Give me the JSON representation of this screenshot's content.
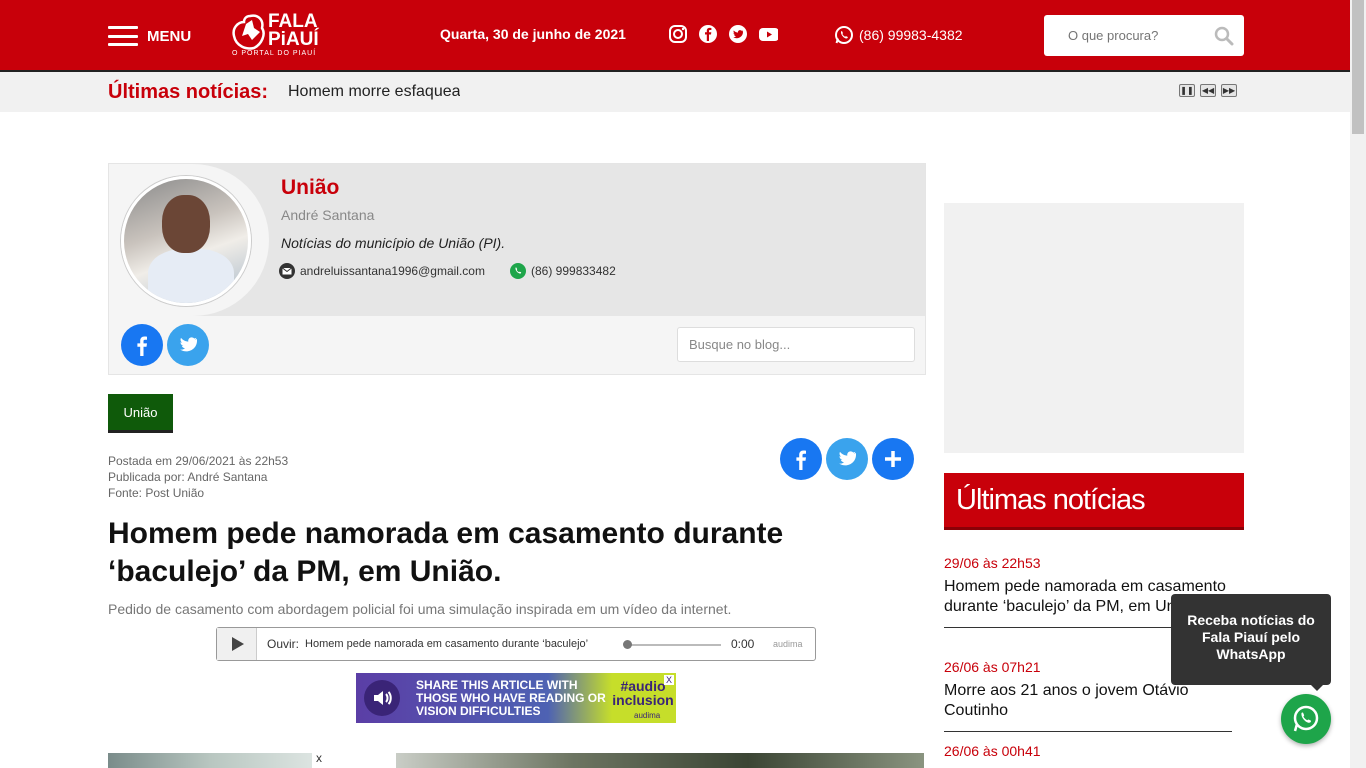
{
  "header": {
    "menu_label": "MENU",
    "logo": {
      "line1": "FALA",
      "line2": "PiAUÍ",
      "tagline": "O PORTAL DO PIAUÍ"
    },
    "date": "Quarta, 30 de junho de 2021",
    "social_icons": [
      "instagram-icon",
      "facebook-icon",
      "twitter-icon",
      "youtube-icon"
    ],
    "phone": "(86) 99983-4382",
    "search_placeholder": "O que procura?"
  },
  "ticker": {
    "label": "Últimas notícias:",
    "text": "Homem morre esfaqueado",
    "controls": [
      "pause",
      "previous",
      "next"
    ]
  },
  "blog": {
    "title": "União",
    "author": "André Santana",
    "description": "Notícias do município de União (PI).",
    "email": "andreluissantana1996@gmail.com",
    "whatsapp": "(86) 999833482",
    "search_placeholder": "Busque no blog..."
  },
  "article": {
    "category": "União",
    "posted": "Postada em 29/06/2021 às 22h53",
    "published_by": "Publicada por: André Santana",
    "source": "Fonte: Post União",
    "headline": "Homem pede namorada em casamento durante ‘baculejo’ da PM, em União.",
    "subheadline": "Pedido de casamento com abordagem policial foi uma simulação inspirada em um vídeo da internet.",
    "player": {
      "label": "Ouvir:",
      "title": "Homem pede namorada em casamento durante ‘baculejo’ da PM, em União.",
      "time": "0:00",
      "brand": "audima"
    },
    "banner": {
      "text": "SHARE THIS ARTICLE WITH THOSE WHO HAVE READING OR VISION DIFFICULTIES",
      "tag": "#audio inclusion",
      "brand": "audima",
      "close": "X"
    },
    "image_close": "x"
  },
  "sidebar": {
    "heading": "Últimas notícias",
    "news": [
      {
        "date": "29/06 às 22h53",
        "title": "Homem pede namorada em casamento durante ‘baculejo’ da PM, em União."
      },
      {
        "date": "26/06 às 07h21",
        "title": "Morre aos 21 anos o jovem Otávio Coutinho"
      },
      {
        "date": "26/06 às 00h41",
        "title": ""
      }
    ]
  },
  "whatsapp_widget": {
    "tooltip": "Receba notícias do Fala Piauí pelo WhatsApp"
  },
  "colors": {
    "brand_red": "#c8000a",
    "category_green": "#0f5a0a",
    "facebook": "#1877f2",
    "twitter": "#3aa3ed",
    "whatsapp": "#1ea54a"
  }
}
